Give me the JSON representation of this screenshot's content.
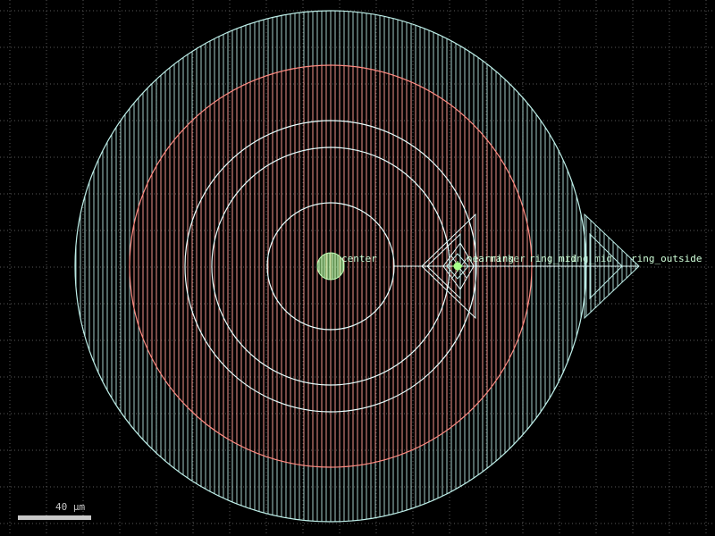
{
  "layout_view": {
    "background": "#000000",
    "grid_color": "#5a5a5a",
    "colors": {
      "outer_hatch": "#bff0ea",
      "red_hatch": "#ff8b82",
      "ring": "#e8ffff",
      "center_fill": "#a8ff8a",
      "label": "#cfffd8",
      "scale_bar": "#c8c8c8",
      "scale_text": "#c8c8c8"
    },
    "labels": {
      "center": "center",
      "cluster_a": "nearring",
      "cluster_b": "ring_mid",
      "cluster_c": "ring_outside",
      "cluster_d": "marker"
    },
    "scale_bar": {
      "label": "40 µm"
    }
  }
}
